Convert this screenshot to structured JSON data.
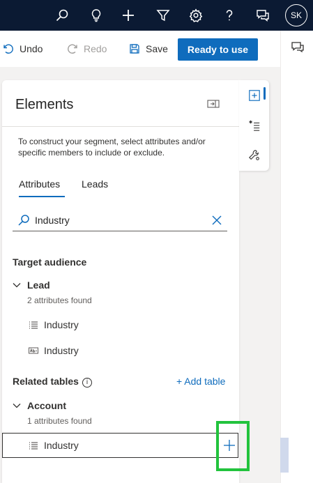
{
  "topbar": {
    "icons": [
      "search-icon",
      "lightbulb-icon",
      "plus-icon",
      "filter-icon",
      "gear-icon",
      "help-icon",
      "feedback-icon"
    ],
    "avatar_initials": "SK"
  },
  "commandbar": {
    "undo_label": "Undo",
    "redo_label": "Redo",
    "save_label": "Save",
    "ready_label": "Ready to use"
  },
  "panel": {
    "title": "Elements",
    "description": "To construct your segment, select attributes and/or specific members to include or exclude.",
    "tabs": [
      {
        "label": "Attributes",
        "active": true
      },
      {
        "label": "Leads",
        "active": false
      }
    ],
    "search": {
      "value": "Industry"
    },
    "target_audience": {
      "heading": "Target audience",
      "group": {
        "name": "Lead",
        "count_text": "2 attributes found",
        "items": [
          {
            "label": "Industry",
            "icon": "list-icon"
          },
          {
            "label": "Industry",
            "icon": "text-field-icon"
          }
        ]
      }
    },
    "related_tables": {
      "heading": "Related tables",
      "add_label": "+ Add table",
      "group": {
        "name": "Account",
        "count_text": "1 attributes found",
        "items": [
          {
            "label": "Industry",
            "icon": "list-icon"
          }
        ]
      }
    }
  },
  "colors": {
    "topbar": "#0b1a33",
    "accent": "#0f6cbd",
    "highlight": "#22c33d"
  }
}
